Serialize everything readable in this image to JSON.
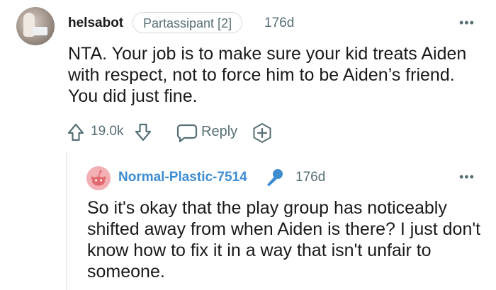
{
  "parent_comment": {
    "username": "helsabot",
    "flair": "Partassipant [2]",
    "age": "176d",
    "more_icon": "more-horizontal-icon",
    "body": "NTA. Your job is to make sure your kid treats Aiden with respect, not to force him to be Aiden’s friend. You did just fine.",
    "score": "19.0k",
    "reply_label": "Reply",
    "icons": {
      "upvote": "arrow-up-icon",
      "downvote": "arrow-down-icon",
      "reply": "comment-bubble-icon",
      "award": "award-plus-icon"
    }
  },
  "reply_comment": {
    "username": "Normal-Plastic-7514",
    "age": "176d",
    "more_icon": "more-horizontal-icon",
    "op_icon": "microphone-icon",
    "body": "So it's okay that the play group has noticeably shifted away from when Aiden is there? I just don't know how to fix it in a way that isn't unfair to someone."
  },
  "colors": {
    "meta_gray": "#576f76",
    "op_blue": "#3e8dd1",
    "text": "#1a1a1b",
    "avatar_pink": "#f3b0b4"
  }
}
